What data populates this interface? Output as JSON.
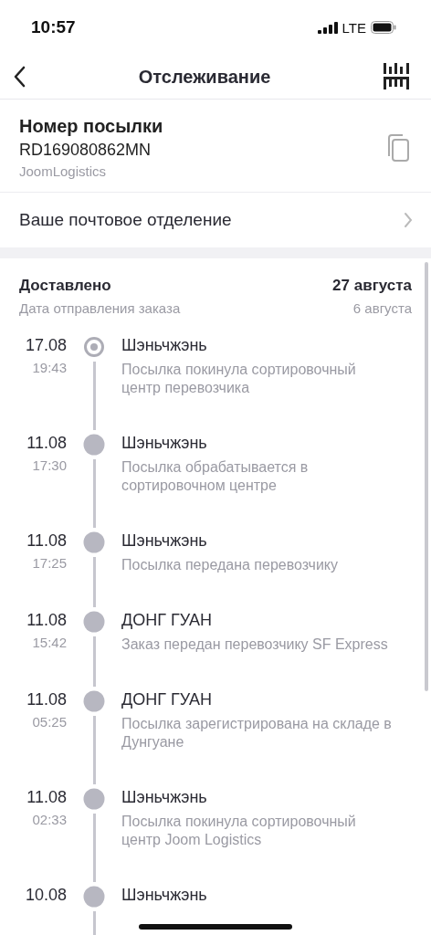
{
  "status_bar": {
    "time": "10:57",
    "network": "LTE"
  },
  "header": {
    "title": "Отслеживание"
  },
  "parcel": {
    "heading": "Номер посылки",
    "number": "RD169080862MN",
    "carrier": "JoomLogistics"
  },
  "post_office": {
    "label": "Ваше почтовое отделение"
  },
  "summary": {
    "status": "Доставлено",
    "delivery_date": "27 августа",
    "sent_label": "Дата отправления заказа",
    "sent_date": "6 августа"
  },
  "events": [
    {
      "date": "17.08",
      "time": "19:43",
      "city": "Шэньчжэнь",
      "description": "Посылка покинула сортировочный центр перевозчика",
      "current": true
    },
    {
      "date": "11.08",
      "time": "17:30",
      "city": "Шэньчжэнь",
      "description": "Посылка обрабатывается в сортировочном центре",
      "current": false
    },
    {
      "date": "11.08",
      "time": "17:25",
      "city": "Шэньчжэнь",
      "description": "Посылка передана перевозчику",
      "current": false
    },
    {
      "date": "11.08",
      "time": "15:42",
      "city": "ДОНГ ГУАН",
      "description": "Заказ передан перевозчику SF Express",
      "current": false
    },
    {
      "date": "11.08",
      "time": "05:25",
      "city": "ДОНГ ГУАН",
      "description": "Посылка зарегистрирована на складе в Дунгуане",
      "current": false
    },
    {
      "date": "11.08",
      "time": "02:33",
      "city": "Шэньчжэнь",
      "description": "Посылка покинула сортировочный центр Joom Logistics",
      "current": false
    },
    {
      "date": "10.08",
      "city": "Шэньчжэнь",
      "current": false
    }
  ]
}
